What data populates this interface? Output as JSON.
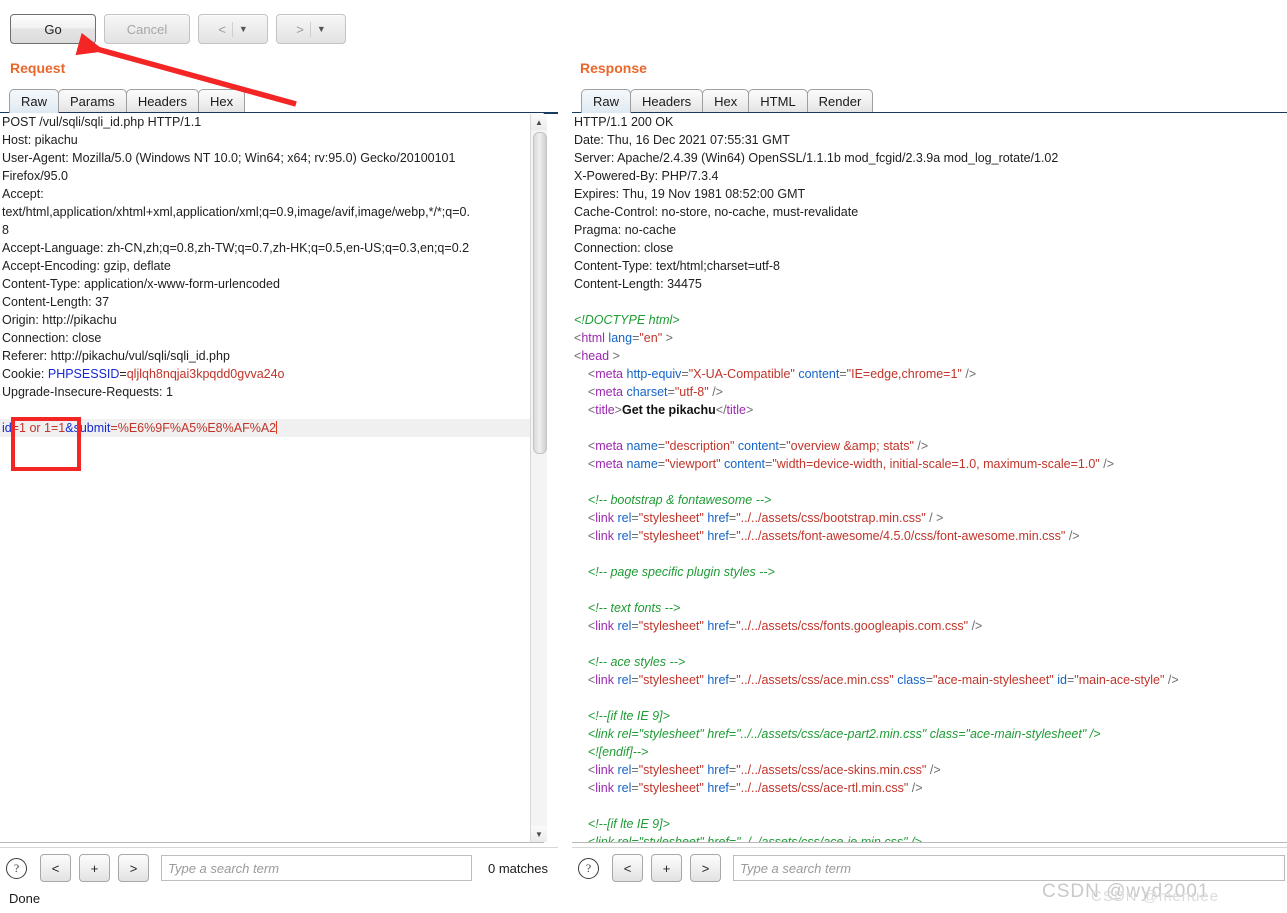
{
  "toolbar": {
    "go_label": "Go",
    "cancel_label": "Cancel",
    "back_glyph": "<",
    "forward_glyph": ">",
    "caret_glyph": "▼"
  },
  "request": {
    "title": "Request",
    "tabs": [
      {
        "label": "Raw",
        "active": true
      },
      {
        "label": "Params",
        "active": false
      },
      {
        "label": "Headers",
        "active": false
      },
      {
        "label": "Hex",
        "active": false
      }
    ],
    "lines": [
      "POST /vul/sqli/sqli_id.php HTTP/1.1",
      "Host: pikachu",
      "User-Agent: Mozilla/5.0 (Windows NT 10.0; Win64; x64; rv:95.0) Gecko/20100101",
      "Firefox/95.0",
      "Accept:",
      "text/html,application/xhtml+xml,application/xml;q=0.9,image/avif,image/webp,*/*;q=0.",
      "8",
      "Accept-Language: zh-CN,zh;q=0.8,zh-TW;q=0.7,zh-HK;q=0.5,en-US;q=0.3,en;q=0.2",
      "Accept-Encoding: gzip, deflate",
      "Content-Type: application/x-www-form-urlencoded",
      "Content-Length: 37",
      "Origin: http://pikachu",
      "Connection: close",
      "Referer: http://pikachu/vul/sqli/sqli_id.php"
    ],
    "cookie_line": {
      "prefix": "Cookie: ",
      "name": "PHPSESSID",
      "equals": "=",
      "value": "qljlqh8nqjai3kpqdd0gvva24o"
    },
    "upgrade_line": "Upgrade-Insecure-Requests: 1",
    "body_line": {
      "param1_name": "id",
      "param1_eq": "=",
      "param1_value": "1 or 1=1",
      "amp": "&",
      "param2_name": "submit",
      "param2_eq": "=",
      "param2_value": "%E6%9F%A5%E8%AF%A2"
    },
    "search": {
      "help_glyph": "?",
      "prev_label": "<",
      "add_label": "+",
      "next_label": ">",
      "placeholder": "Type a search term",
      "value": "",
      "matches": "0 matches"
    }
  },
  "response": {
    "title": "Response",
    "tabs": [
      {
        "label": "Raw",
        "active": true
      },
      {
        "label": "Headers",
        "active": false
      },
      {
        "label": "Hex",
        "active": false
      },
      {
        "label": "HTML",
        "active": false
      },
      {
        "label": "Render",
        "active": false
      }
    ],
    "headers": [
      "HTTP/1.1 200 OK",
      "Date: Thu, 16 Dec 2021 07:55:31 GMT",
      "Server: Apache/2.4.39 (Win64) OpenSSL/1.1.1b mod_fcgid/2.3.9a mod_log_rotate/1.02",
      "X-Powered-By: PHP/7.3.4",
      "Expires: Thu, 19 Nov 1981 08:52:00 GMT",
      "Cache-Control: no-store, no-cache, must-revalidate",
      "Pragma: no-cache",
      "Connection: close",
      "Content-Type: text/html;charset=utf-8",
      "Content-Length: 34475"
    ],
    "body": [
      {
        "indent": 0,
        "type": "doctype",
        "text": "<!DOCTYPE html>"
      },
      {
        "indent": 0,
        "type": "tag",
        "tag": "html",
        "attrs": [
          {
            "name": "lang",
            "value": "en"
          }
        ],
        "close": ">"
      },
      {
        "indent": 0,
        "type": "tag",
        "tag": "head",
        "attrs": [],
        "close": ">"
      },
      {
        "indent": 1,
        "type": "tag",
        "tag": "meta",
        "attrs": [
          {
            "name": "http-equiv",
            "value": "X-UA-Compatible"
          },
          {
            "name": "content",
            "value": "IE=edge,chrome=1"
          }
        ],
        "close": "/>"
      },
      {
        "indent": 1,
        "type": "tag",
        "tag": "meta",
        "attrs": [
          {
            "name": "charset",
            "value": "utf-8"
          }
        ],
        "close": "/>"
      },
      {
        "indent": 1,
        "type": "title",
        "tag": "title",
        "text": "Get the pikachu"
      },
      {
        "indent": 0,
        "type": "blank"
      },
      {
        "indent": 1,
        "type": "tag",
        "tag": "meta",
        "attrs": [
          {
            "name": "name",
            "value": "description"
          },
          {
            "name": "content",
            "value": "overview &amp; stats"
          }
        ],
        "close": "/>"
      },
      {
        "indent": 1,
        "type": "tag",
        "tag": "meta",
        "attrs": [
          {
            "name": "name",
            "value": "viewport"
          },
          {
            "name": "content",
            "value": "width=device-width, initial-scale=1.0, maximum-scale=1.0"
          }
        ],
        "close": "/>"
      },
      {
        "indent": 0,
        "type": "blank"
      },
      {
        "indent": 1,
        "type": "comment",
        "text": "<!-- bootstrap & fontawesome -->"
      },
      {
        "indent": 1,
        "type": "tag",
        "tag": "link",
        "attrs": [
          {
            "name": "rel",
            "value": "stylesheet"
          },
          {
            "name": "href",
            "value": "../../assets/css/bootstrap.min.css"
          }
        ],
        "close": "/ >"
      },
      {
        "indent": 1,
        "type": "tag",
        "tag": "link",
        "attrs": [
          {
            "name": "rel",
            "value": "stylesheet"
          },
          {
            "name": "href",
            "value": "../../assets/font-awesome/4.5.0/css/font-awesome.min.css"
          }
        ],
        "close": "/>"
      },
      {
        "indent": 0,
        "type": "blank"
      },
      {
        "indent": 1,
        "type": "comment",
        "text": "<!-- page specific plugin styles -->"
      },
      {
        "indent": 0,
        "type": "blank"
      },
      {
        "indent": 1,
        "type": "comment",
        "text": "<!-- text fonts -->"
      },
      {
        "indent": 1,
        "type": "tag",
        "tag": "link",
        "attrs": [
          {
            "name": "rel",
            "value": "stylesheet"
          },
          {
            "name": "href",
            "value": "../../assets/css/fonts.googleapis.com.css"
          }
        ],
        "close": "/>"
      },
      {
        "indent": 0,
        "type": "blank"
      },
      {
        "indent": 1,
        "type": "comment",
        "text": "<!-- ace styles -->"
      },
      {
        "indent": 1,
        "type": "tag",
        "tag": "link",
        "attrs": [
          {
            "name": "rel",
            "value": "stylesheet"
          },
          {
            "name": "href",
            "value": "../../assets/css/ace.min.css"
          },
          {
            "name": "class",
            "value": "ace-main-stylesheet"
          },
          {
            "name": "id",
            "value": "main-ace-style"
          }
        ],
        "close": "/>"
      },
      {
        "indent": 0,
        "type": "blank"
      },
      {
        "indent": 1,
        "type": "comment",
        "text": "<!--[if lte IE 9]>"
      },
      {
        "indent": 1,
        "type": "comment",
        "text": "<link rel=\"stylesheet\" href=\"../../assets/css/ace-part2.min.css\" class=\"ace-main-stylesheet\" />"
      },
      {
        "indent": 1,
        "type": "comment",
        "text": "<![endif]-->"
      },
      {
        "indent": 1,
        "type": "tag",
        "tag": "link",
        "attrs": [
          {
            "name": "rel",
            "value": "stylesheet"
          },
          {
            "name": "href",
            "value": "../../assets/css/ace-skins.min.css"
          }
        ],
        "close": "/>"
      },
      {
        "indent": 1,
        "type": "tag",
        "tag": "link",
        "attrs": [
          {
            "name": "rel",
            "value": "stylesheet"
          },
          {
            "name": "href",
            "value": "../../assets/css/ace-rtl.min.css"
          }
        ],
        "close": "/>"
      },
      {
        "indent": 0,
        "type": "blank"
      },
      {
        "indent": 1,
        "type": "comment",
        "text": "<!--[if lte IE 9]>"
      },
      {
        "indent": 1,
        "type": "comment",
        "text": "<link rel=\"stylesheet\" href=\"../../assets/css/ace-ie.min.css\" />"
      }
    ],
    "search": {
      "help_glyph": "?",
      "prev_label": "<",
      "add_label": "+",
      "next_label": ">",
      "placeholder": "Type a search term",
      "value": ""
    }
  },
  "status": {
    "text": "Done"
  },
  "watermarks": {
    "primary": "CSDN @wyd2001",
    "secondary": "CSDN @menuee"
  },
  "colors": {
    "accent_title": "#e8672b",
    "annotation_red": "#f42525",
    "tab_underline": "#173a5e",
    "syntax_tag": "#9c27b0",
    "syntax_attr": "#1464c8",
    "syntax_value": "#c0342a",
    "syntax_comment": "#1f9b35",
    "param_name": "#1528d6",
    "param_value": "#c0342a"
  }
}
